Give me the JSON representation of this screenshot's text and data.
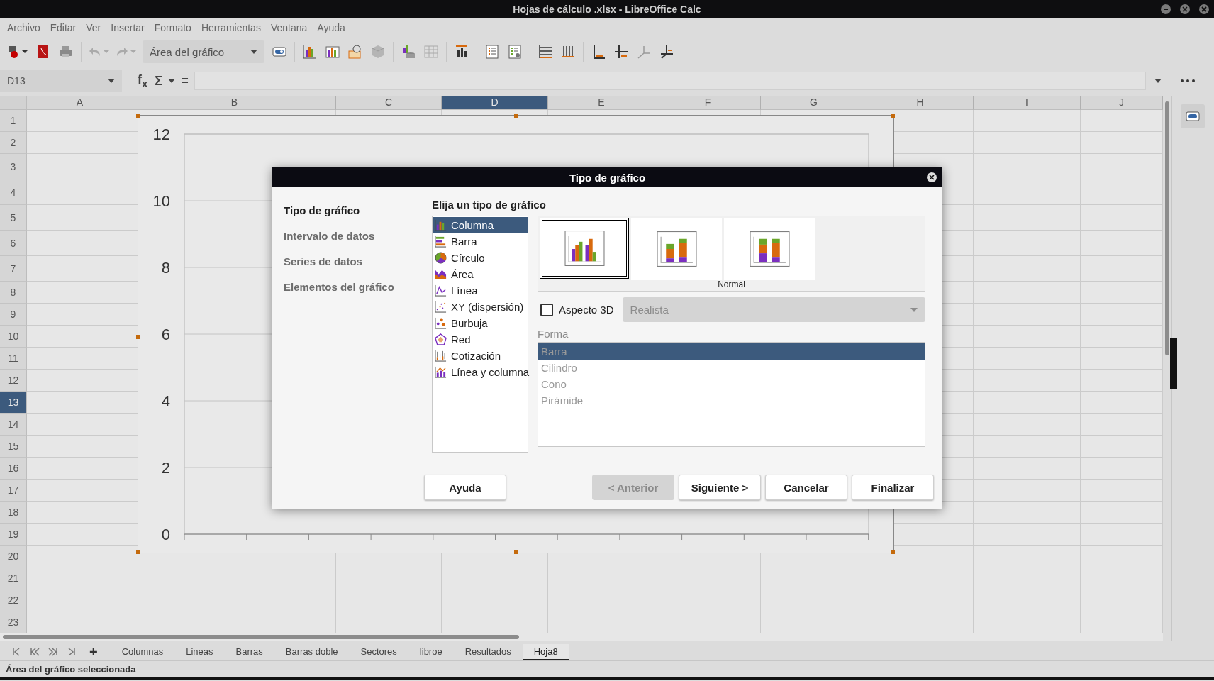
{
  "window": {
    "title": "Hojas de cálculo .xlsx - LibreOffice Calc"
  },
  "menu": [
    "Archivo",
    "Editar",
    "Ver",
    "Insertar",
    "Formato",
    "Herramientas",
    "Ventana",
    "Ayuda"
  ],
  "toolbar": {
    "element_select": "Área del gráfico"
  },
  "formula_bar": {
    "name_box": "D13",
    "function_wizard": "f$_{x}$",
    "sum": "Σ",
    "equals": "="
  },
  "columns": [
    {
      "label": "A",
      "selected": false
    },
    {
      "label": "B",
      "selected": false
    },
    {
      "label": "C",
      "selected": false
    },
    {
      "label": "D",
      "selected": true
    },
    {
      "label": "E",
      "selected": false
    },
    {
      "label": "F",
      "selected": false
    },
    {
      "label": "G",
      "selected": false
    },
    {
      "label": "H",
      "selected": false
    },
    {
      "label": "I",
      "selected": false
    },
    {
      "label": "J",
      "selected": false
    }
  ],
  "rows": [
    {
      "label": "1",
      "selected": false
    },
    {
      "label": "2",
      "selected": false
    },
    {
      "label": "3",
      "selected": false
    },
    {
      "label": "4",
      "selected": false
    },
    {
      "label": "5",
      "selected": false
    },
    {
      "label": "6",
      "selected": false
    },
    {
      "label": "7",
      "selected": false
    },
    {
      "label": "8",
      "selected": false
    },
    {
      "label": "9",
      "selected": false
    },
    {
      "label": "10",
      "selected": false
    },
    {
      "label": "11",
      "selected": false
    },
    {
      "label": "12",
      "selected": false
    },
    {
      "label": "13",
      "selected": true
    },
    {
      "label": "14",
      "selected": false
    },
    {
      "label": "15",
      "selected": false
    },
    {
      "label": "16",
      "selected": false
    },
    {
      "label": "17",
      "selected": false
    },
    {
      "label": "18",
      "selected": false
    },
    {
      "label": "19",
      "selected": false
    },
    {
      "label": "20",
      "selected": false
    },
    {
      "label": "21",
      "selected": false
    },
    {
      "label": "22",
      "selected": false
    },
    {
      "label": "23",
      "selected": false
    }
  ],
  "chart": {
    "y_axis_labels": [
      "12",
      "10",
      "8",
      "6",
      "4",
      "2",
      "0"
    ]
  },
  "dialog": {
    "title": "Tipo de gráfico",
    "steps": [
      {
        "label": "Tipo de gráfico",
        "selected": true
      },
      {
        "label": "Intervalo de datos",
        "selected": false
      },
      {
        "label": "Series de datos",
        "selected": false
      },
      {
        "label": "Elementos del gráfico",
        "selected": false
      }
    ],
    "heading": "Elija un tipo de gráfico",
    "chart_types": [
      {
        "label": "Columna",
        "kind": "column",
        "selected": true
      },
      {
        "label": "Barra",
        "kind": "bar",
        "selected": false
      },
      {
        "label": "Círculo",
        "kind": "pie",
        "selected": false
      },
      {
        "label": "Área",
        "kind": "area",
        "selected": false
      },
      {
        "label": "Línea",
        "kind": "line",
        "selected": false
      },
      {
        "label": "XY (dispersión)",
        "kind": "scatter",
        "selected": false
      },
      {
        "label": "Burbuja",
        "kind": "bubble",
        "selected": false
      },
      {
        "label": "Red",
        "kind": "net",
        "selected": false
      },
      {
        "label": "Cotización",
        "kind": "stock",
        "selected": false
      },
      {
        "label": "Línea y columna",
        "kind": "column-line",
        "selected": false
      }
    ],
    "variants": [
      {
        "kind": "clustered",
        "selected": true
      },
      {
        "kind": "stacked",
        "selected": false
      },
      {
        "kind": "percent",
        "selected": false
      }
    ],
    "variant_caption": "Normal",
    "aspect_3d": {
      "label": "Aspecto 3D",
      "checked": false
    },
    "style_select": {
      "value": "Realista",
      "disabled": true
    },
    "shape_label": "Forma",
    "shapes": {
      "disabled": true,
      "items": [
        {
          "label": "Barra",
          "selected": true
        },
        {
          "label": "Cilindro",
          "selected": false
        },
        {
          "label": "Cono",
          "selected": false
        },
        {
          "label": "Pirámide",
          "selected": false
        }
      ]
    },
    "buttons": [
      {
        "label": "Ayuda",
        "disabled": false
      },
      {
        "label": "< Anterior",
        "disabled": true
      },
      {
        "label": "Siguiente >",
        "disabled": false
      },
      {
        "label": "Cancelar",
        "disabled": false
      },
      {
        "label": "Finalizar",
        "disabled": false
      }
    ]
  },
  "sheet_tabs": [
    {
      "label": "Columnas",
      "selected": false
    },
    {
      "label": "Lineas",
      "selected": false
    },
    {
      "label": "Barras",
      "selected": false
    },
    {
      "label": "Barras doble",
      "selected": false
    },
    {
      "label": "Sectores",
      "selected": false
    },
    {
      "label": "libroe",
      "selected": false
    },
    {
      "label": "Resultados",
      "selected": false
    },
    {
      "label": "Hoja8",
      "selected": true
    }
  ],
  "add_sheet": "+",
  "status_bar": "Área del gráfico seleccionada"
}
